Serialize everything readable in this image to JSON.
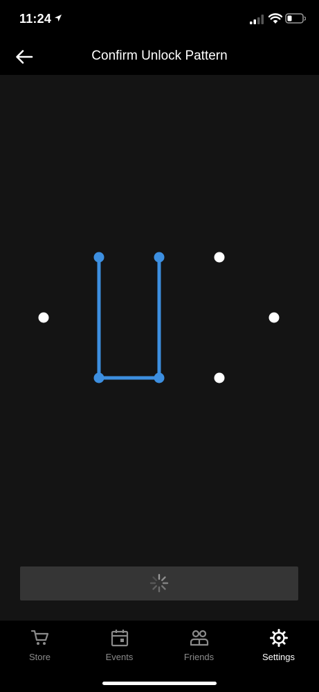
{
  "status_bar": {
    "time": "11:24"
  },
  "header": {
    "title": "Confirm Unlock Pattern",
    "back_icon": "arrow-left-icon"
  },
  "pattern": {
    "accent_color": "#3d8fe0",
    "dot_color": "#ffffff",
    "selected_sequence": [
      "top-left",
      "bottom-left",
      "bottom-center",
      "top-center"
    ]
  },
  "confirm_button": {
    "state": "loading",
    "icon": "spinner-icon"
  },
  "tabs": [
    {
      "label": "Store",
      "icon": "cart-icon",
      "active": false
    },
    {
      "label": "Events",
      "icon": "calendar-icon",
      "active": false
    },
    {
      "label": "Friends",
      "icon": "people-icon",
      "active": false
    },
    {
      "label": "Settings",
      "icon": "gear-icon",
      "active": true
    }
  ]
}
